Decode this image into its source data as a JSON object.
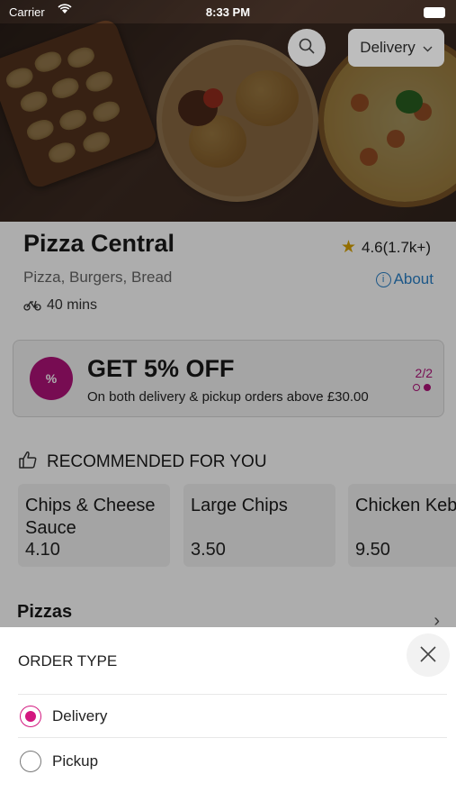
{
  "status": {
    "carrier": "Carrier",
    "time": "8:33 PM"
  },
  "header": {
    "delivery_label": "Delivery"
  },
  "restaurant": {
    "name": "Pizza Central",
    "rating": "4.6(1.7k+)",
    "cuisines": "Pizza, Burgers, Bread",
    "about": "About",
    "delivery_time": "40 mins"
  },
  "offer": {
    "badge": "%",
    "headline": "GET 5% OFF",
    "subtitle": "On both delivery & pickup orders above £30.00",
    "pager": "2/2"
  },
  "recommended": {
    "title": "RECOMMENDED FOR YOU",
    "items": [
      {
        "name": "Chips & Cheese Sauce",
        "price": "4.10"
      },
      {
        "name": "Large Chips",
        "price": "3.50"
      },
      {
        "name": "Chicken Kebab",
        "price": "9.50"
      }
    ]
  },
  "section": {
    "title": "Pizzas"
  },
  "sheet": {
    "title": "ORDER TYPE",
    "options": [
      {
        "label": "Delivery",
        "selected": true
      },
      {
        "label": "Pickup",
        "selected": false
      }
    ]
  },
  "colors": {
    "accent": "#d3177f",
    "link": "#2c82c9",
    "star": "#d9a300"
  },
  "icons": [
    "search-icon",
    "chevron-down-icon",
    "star-icon",
    "info-icon",
    "bike-icon",
    "discount-icon",
    "thumbs-up-icon",
    "chevron-right-icon",
    "close-icon"
  ]
}
